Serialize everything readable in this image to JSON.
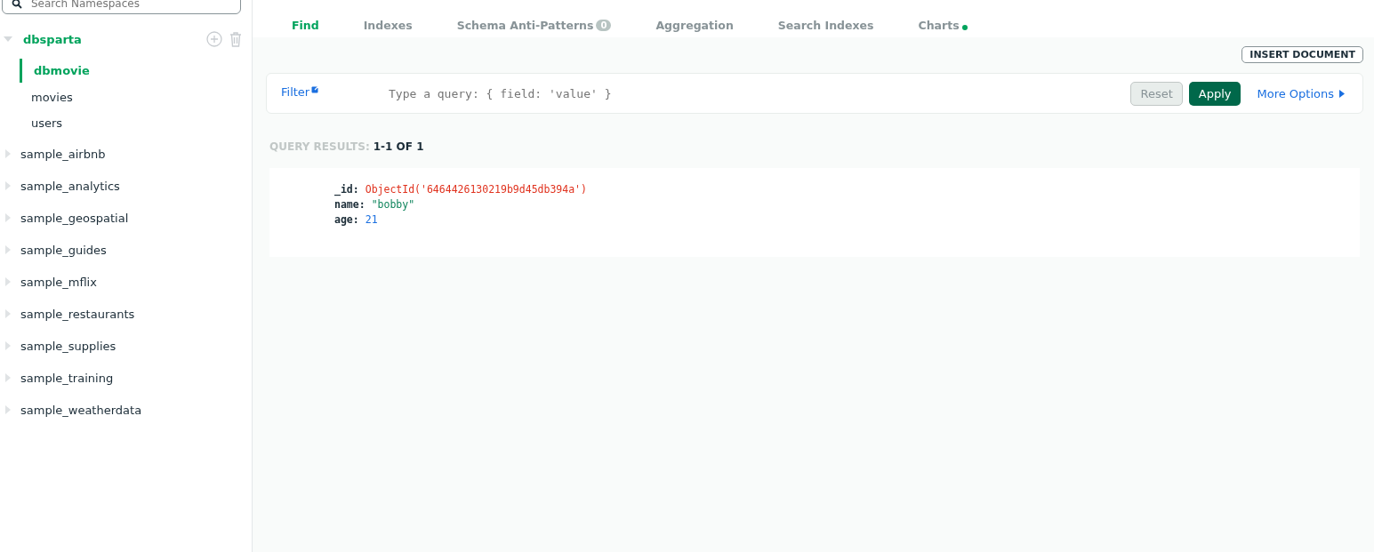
{
  "sidebar": {
    "search": {
      "placeholder": "Search Namespaces"
    },
    "databases": [
      {
        "name": "dbsparta",
        "expanded": true,
        "children": [
          {
            "name": "dbmovie",
            "selected": true
          },
          {
            "name": "movies",
            "selected": false
          },
          {
            "name": "users",
            "selected": false
          }
        ]
      },
      {
        "name": "sample_airbnb",
        "expanded": false
      },
      {
        "name": "sample_analytics",
        "expanded": false
      },
      {
        "name": "sample_geospatial",
        "expanded": false
      },
      {
        "name": "sample_guides",
        "expanded": false
      },
      {
        "name": "sample_mflix",
        "expanded": false
      },
      {
        "name": "sample_restaurants",
        "expanded": false
      },
      {
        "name": "sample_supplies",
        "expanded": false
      },
      {
        "name": "sample_training",
        "expanded": false
      },
      {
        "name": "sample_weatherdata",
        "expanded": false
      }
    ]
  },
  "tabs": [
    {
      "label": "Find",
      "selected": true
    },
    {
      "label": "Indexes",
      "selected": false
    },
    {
      "label": "Schema Anti-Patterns",
      "selected": false,
      "count": "0"
    },
    {
      "label": "Aggregation",
      "selected": false
    },
    {
      "label": "Search Indexes",
      "selected": false
    },
    {
      "label": "Charts",
      "selected": false,
      "dot": true
    }
  ],
  "insert_button": "INSERT DOCUMENT",
  "filter": {
    "label": "Filter",
    "placeholder": "Type a query: { field: 'value' }",
    "reset": "Reset",
    "apply": "Apply",
    "more": "More Options"
  },
  "results": {
    "label": "QUERY RESULTS:",
    "range": "1-1 OF 1"
  },
  "document": [
    {
      "key": "_id:",
      "value": "ObjectId('6464426130219b9d45db394a')",
      "kind": "objectid"
    },
    {
      "key": "name:",
      "value": "\"bobby\"",
      "kind": "string"
    },
    {
      "key": "age:",
      "value": "21",
      "kind": "number"
    }
  ]
}
